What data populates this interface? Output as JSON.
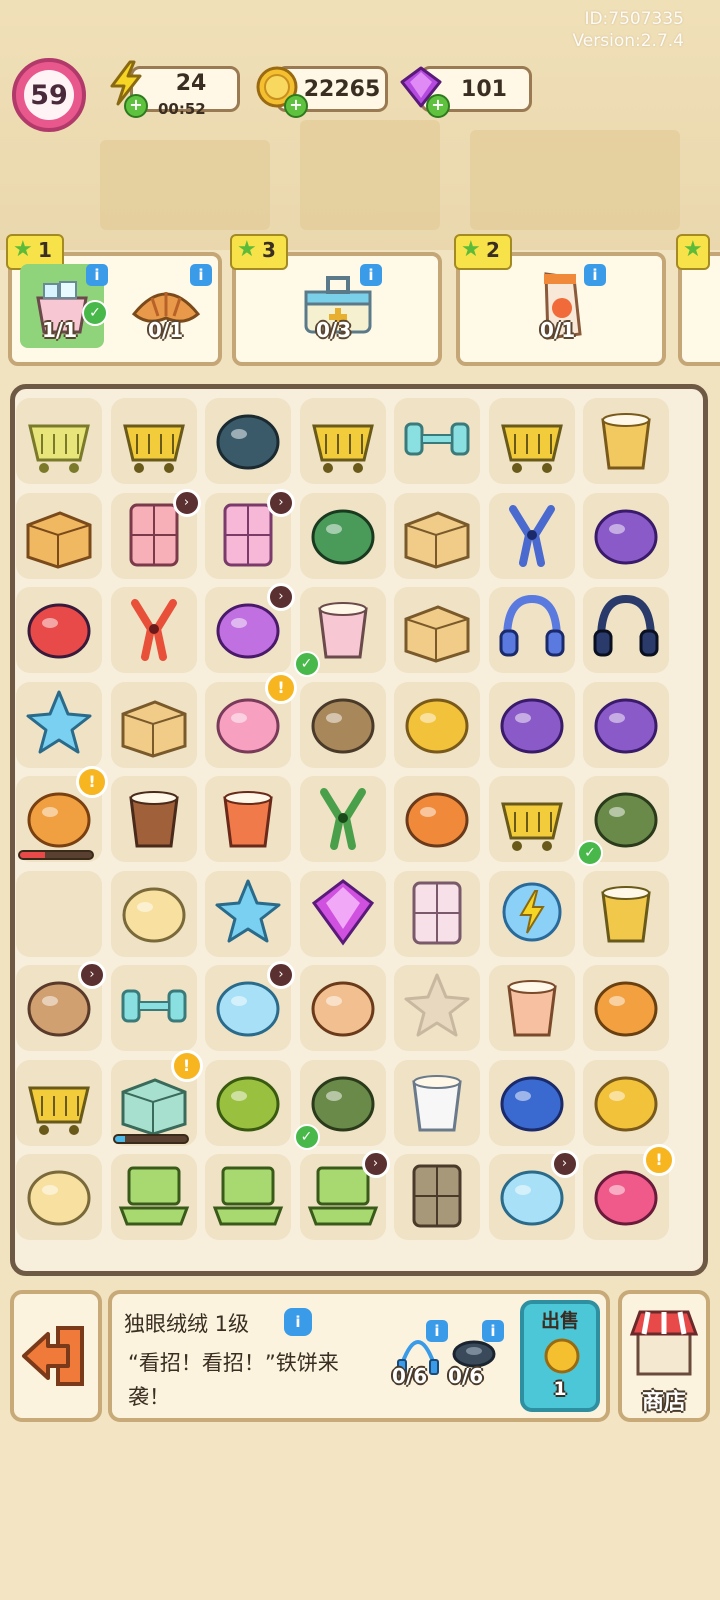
{
  "meta": {
    "id_text": "ID:7507335",
    "version_text": "Version:2.7.4"
  },
  "hud": {
    "level": "59",
    "energy": "24",
    "energy_timer": "00:52",
    "coins": "22265",
    "gems": "101"
  },
  "orders": [
    {
      "stars": "1",
      "items": [
        {
          "icon": "ice-bucket-icon",
          "count": "1/1",
          "done": true
        },
        {
          "icon": "croissant-icon",
          "count": "0/1"
        }
      ]
    },
    {
      "stars": "3",
      "items": [
        {
          "icon": "first-aid-kit-icon",
          "count": "0/3"
        }
      ]
    },
    {
      "stars": "2",
      "items": [
        {
          "icon": "snack-bag-icon",
          "count": "0/1"
        }
      ]
    }
  ],
  "board": {
    "rows": [
      [
        "basket-icon",
        "cart-icon",
        "hood-icon",
        "cart-icon",
        "dumbbell-icon",
        "cart-icon",
        "bucket-icon"
      ],
      [
        "salad-box-icon",
        "suitcase-icon",
        "fridge-icon",
        "toolbox-icon",
        "box-icon",
        "massage-gun-icon",
        "purple-bag-icon"
      ],
      [
        "vr-headset-icon",
        "key-icon",
        "robot-icon",
        "ice-bucket-icon",
        "box-icon",
        "neck-pillow-icon",
        "headphones-icon"
      ],
      [
        "sparkle-icon",
        "box-icon",
        "pink-monster-icon",
        "chest-icon",
        "flower-basket-icon",
        "purple-bag-icon",
        "purple-bag-icon"
      ],
      [
        "orange-monster-icon",
        "coffee-icon",
        "soda-can-icon",
        "pliers-icon",
        "cooler-icon",
        "cart-icon",
        "glove-icon"
      ],
      [
        "empty",
        "chick-icon",
        "star-icon",
        "gem-icon",
        "milk-carton-icon",
        "energy-orb-icon",
        "plant-pot-icon"
      ],
      [
        "egg-icon",
        "dumbbell-icon",
        "robot-vacuum-icon",
        "sandwich-icon",
        "star-slot-icon",
        "cup-icon",
        "sock-icon"
      ],
      [
        "cart-icon",
        "crate-icon",
        "coin-sack-icon",
        "glove-icon",
        "bottle-icon",
        "speaker-icon",
        "flower-basket-icon"
      ],
      [
        "chick-icon",
        "laptop-icon",
        "laptop-icon",
        "laptop-icon",
        "cabinet-icon",
        "robot-vacuum-icon",
        "backpack-icon"
      ]
    ]
  },
  "selected_item": {
    "name": "独眼绒绒 1级",
    "description": "“看招！看招！”铁饼来袭！",
    "requirements": [
      {
        "icon": "jump-rope-icon",
        "count": "0/6"
      },
      {
        "icon": "discus-icon",
        "count": "0/6"
      }
    ],
    "sell_label": "出售",
    "sell_price": "1"
  },
  "shop_label": "商店",
  "colors": {
    "level_pink": "#e8588c",
    "gem_purple": "#b44ae0",
    "coin_gold": "#f5c030",
    "sell_teal": "#4cc7d8",
    "exit_orange": "#f07a3a"
  }
}
